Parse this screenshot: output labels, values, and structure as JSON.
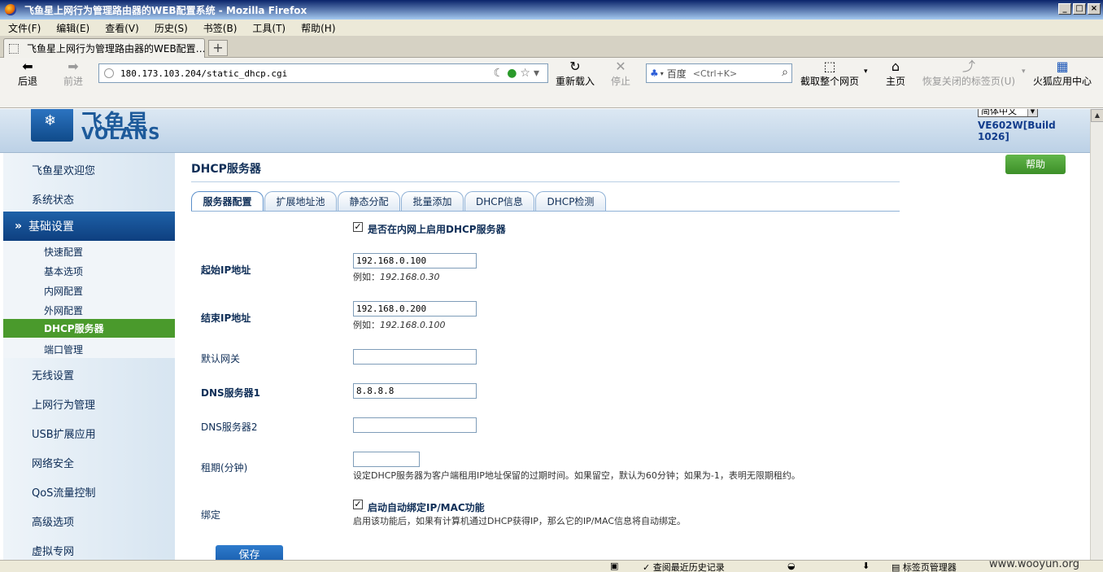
{
  "window": {
    "title": "飞鱼星上网行为管理路由器的WEB配置系统 - Mozilla Firefox",
    "min": "_",
    "max": "□",
    "close": "×"
  },
  "menu": [
    "文件(F)",
    "编辑(E)",
    "查看(V)",
    "历史(S)",
    "书签(B)",
    "工具(T)",
    "帮助(H)"
  ],
  "tab": {
    "title": "飞鱼星上网行为管理路由器的WEB配置…",
    "close": "×",
    "new_tab": "+"
  },
  "nav": {
    "back": "后退",
    "forward": "前进",
    "url": "180.173.103.204/static_dhcp.cgi",
    "reload": "重新载入",
    "stop": "停止",
    "search_engine": "百度",
    "search_placeholder": "<Ctrl+K>",
    "screenshot": "截取整个网页",
    "home": "主页",
    "restore_tab": "恢复关闭的标签页(U)",
    "apps": "火狐应用中心"
  },
  "header": {
    "logo_cn": "飞鱼星",
    "logo_en": "VOLANS",
    "language": "简体中文",
    "model": "VE602W[Build 1026]"
  },
  "sidebar": {
    "welcome": "飞鱼星欢迎您",
    "status": "系统状态",
    "basic": "基础设置",
    "basic_items": [
      "快速配置",
      "基本选项",
      "内网配置",
      "外网配置",
      "DHCP服务器",
      "端口管理"
    ],
    "more": [
      "无线设置",
      "上网行为管理",
      "USB扩展应用",
      "网络安全",
      "QoS流量控制",
      "高级选项",
      "虚拟专网"
    ]
  },
  "help": "帮助",
  "content": {
    "title": "DHCP服务器",
    "tabs": [
      "服务器配置",
      "扩展地址池",
      "静态分配",
      "批量添加",
      "DHCP信息",
      "DHCP检测"
    ],
    "enable_label": "是否在内网上启用DHCP服务器",
    "enable_checked": true,
    "start_ip": {
      "label": "起始IP地址",
      "value": "192.168.0.100",
      "hint_prefix": "例如：",
      "hint_value": "192.168.0.30"
    },
    "end_ip": {
      "label": "结束IP地址",
      "value": "192.168.0.200",
      "hint_prefix": "例如：",
      "hint_value": "192.168.0.100"
    },
    "gateway": {
      "label": "默认网关",
      "value": ""
    },
    "dns1": {
      "label": "DNS服务器1",
      "value": "8.8.8.8"
    },
    "dns2": {
      "label": "DNS服务器2",
      "value": ""
    },
    "lease": {
      "label": "租期(分钟)",
      "value": "",
      "hint": "设定DHCP服务器为客户端租用IP地址保留的过期时间。如果留空，默认为60分钟；如果为-1，表明无限期租约。"
    },
    "bind": {
      "label": "绑定",
      "option": "启动自动绑定IP/MAC功能",
      "checked": true,
      "hint": "启用该功能后，如果有计算机通过DHCP获得IP，那么它的IP/MAC信息将自动绑定。"
    },
    "save": "保存"
  },
  "statusbar": {
    "history": "查阅最近历史记录",
    "tabs": "标签页管理器",
    "watermark": "www.wooyun.org"
  }
}
